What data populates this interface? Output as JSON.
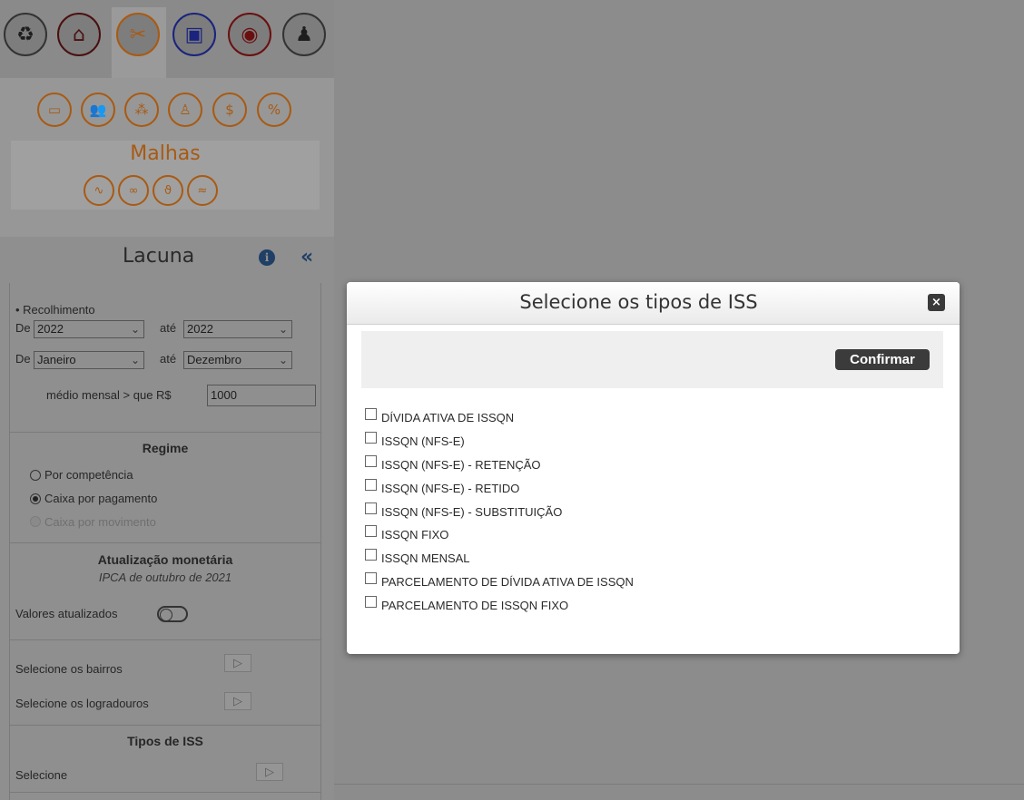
{
  "nav": {
    "icons": [
      "money-cycle-icon",
      "home-icon",
      "professions-icon",
      "book-icon",
      "eye-icon",
      "user-icon"
    ]
  },
  "subnav": {
    "icons": [
      "card-icon",
      "two-people-icon",
      "group-icon",
      "person-icon",
      "money-bag-icon",
      "percent-icon"
    ]
  },
  "malhas": {
    "title": "Malhas",
    "icons": [
      "mesh-1-icon",
      "mesh-2-icon",
      "mesh-3-icon",
      "mesh-4-icon"
    ]
  },
  "lacuna": {
    "title": "Lacuna",
    "info": "i",
    "collapse": "«"
  },
  "filters": {
    "recolhimento_label": "• Recolhimento",
    "de_label": "De",
    "ate_label": "até",
    "year_from": "2022",
    "year_to": "2022",
    "month_from": "Janeiro",
    "month_to": "Dezembro",
    "medio_label": "médio mensal > que R$",
    "medio_value": "1000",
    "regime_title": "Regime",
    "regime_options": [
      "Por competência",
      "Caixa por pagamento",
      "Caixa por movimento"
    ],
    "regime_selected": "Caixa por pagamento",
    "atualizacao_title": "Atualização monetária",
    "atualizacao_sub": "IPCA de outubro de 2021",
    "valores_label": "Valores atualizados",
    "bairros_label": "Selecione os bairros",
    "logradouros_label": "Selecione os logradouros",
    "tipos_title": "Tipos de ISS",
    "tipos_select_label": "Selecione",
    "arrow": "▷"
  },
  "modal": {
    "title": "Selecione os tipos de ISS",
    "close": "×",
    "confirm_label": "Confirmar",
    "options": [
      "DÍVIDA ATIVA DE ISSQN",
      "ISSQN (NFS-E)",
      "ISSQN (NFS-E) - RETENÇÃO",
      "ISSQN (NFS-E) - RETIDO",
      "ISSQN (NFS-E) - SUBSTITUIÇÃO",
      "ISSQN FIXO",
      "ISSQN MENSAL",
      "PARCELAMENTO DE DÍVIDA ATIVA DE ISSQN",
      "PARCELAMENTO DE ISSQN FIXO"
    ]
  },
  "colors": {
    "accent_orange": "#a85a12",
    "navy": "#1f3f66",
    "overlay_gray": "#8c8c8c"
  }
}
